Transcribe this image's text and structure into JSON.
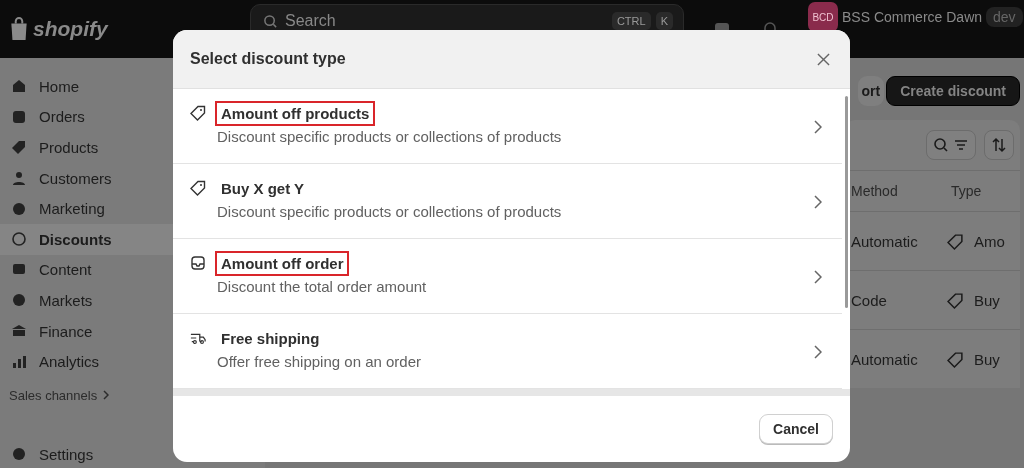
{
  "topbar": {
    "logo": "shopify",
    "search": {
      "placeholder": "Search",
      "keys": [
        "CTRL",
        "K"
      ]
    },
    "store": {
      "initials": "BCD",
      "name": "BSS Commerce Dawn",
      "badge": "dev"
    }
  },
  "sidebar": {
    "items": [
      {
        "label": "Home",
        "selected": false
      },
      {
        "label": "Orders",
        "selected": false
      },
      {
        "label": "Products",
        "selected": false
      },
      {
        "label": "Customers",
        "selected": false
      },
      {
        "label": "Marketing",
        "selected": false
      },
      {
        "label": "Discounts",
        "selected": true
      },
      {
        "label": "Content",
        "selected": false
      },
      {
        "label": "Markets",
        "selected": false
      },
      {
        "label": "Finance",
        "selected": false
      },
      {
        "label": "Analytics",
        "selected": false
      }
    ],
    "sales_channels": "Sales channels",
    "settings": "Settings"
  },
  "header_actions": [
    {
      "label": "ort",
      "kind": "secondary"
    },
    {
      "label": "Create discount",
      "kind": "primary"
    }
  ],
  "table": {
    "columns": [
      "Method",
      "Type"
    ],
    "rows": [
      {
        "method": "Automatic",
        "type": "Amo"
      },
      {
        "method": "Code",
        "type": "Buy"
      },
      {
        "method": "Automatic",
        "type": "Buy"
      }
    ]
  },
  "modal": {
    "title": "Select discount type",
    "options": [
      {
        "title": "Amount off products",
        "description": "Discount specific products or collections of products",
        "kind": "tag",
        "highlighted": true
      },
      {
        "title": "Buy X get Y",
        "description": "Discount specific products or collections of products",
        "kind": "tag",
        "highlighted": false
      },
      {
        "title": "Amount off order",
        "description": "Discount the total order amount",
        "kind": "order",
        "highlighted": true
      },
      {
        "title": "Free shipping",
        "description": "Offer free shipping on an order",
        "kind": "shipping",
        "highlighted": false
      }
    ],
    "cancel": "Cancel"
  }
}
